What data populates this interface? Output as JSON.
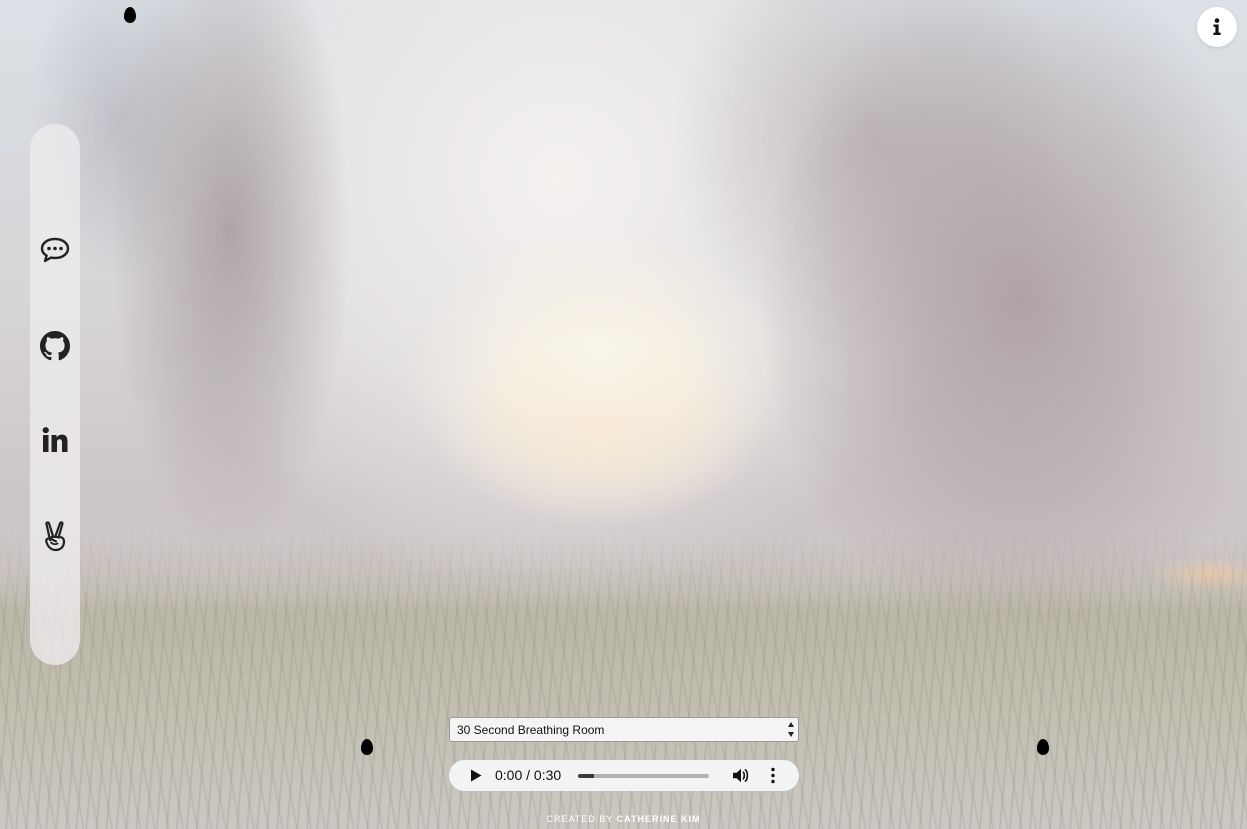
{
  "audio_select": {
    "selected": "30 Second Breathing Room"
  },
  "audio_player": {
    "time_display": "0:00 / 0:30",
    "buffered_fraction": 0.12
  },
  "sidebar": {
    "items": [
      {
        "icon": "chat-bubble-icon",
        "label": "chat"
      },
      {
        "icon": "github-icon",
        "label": "github"
      },
      {
        "icon": "linkedin-icon",
        "label": "linkedin"
      },
      {
        "icon": "angellist-icon",
        "label": "angellist"
      }
    ]
  },
  "info_button": {
    "icon": "info-icon",
    "glyph": "i"
  },
  "footer": {
    "prefix": "CREATED BY",
    "author": "CATHERINE KIM"
  },
  "colors": {
    "sidebar_bg": "#eeeceeC7",
    "player_bg": "#f1f3f4",
    "raindrop": "#000000"
  }
}
